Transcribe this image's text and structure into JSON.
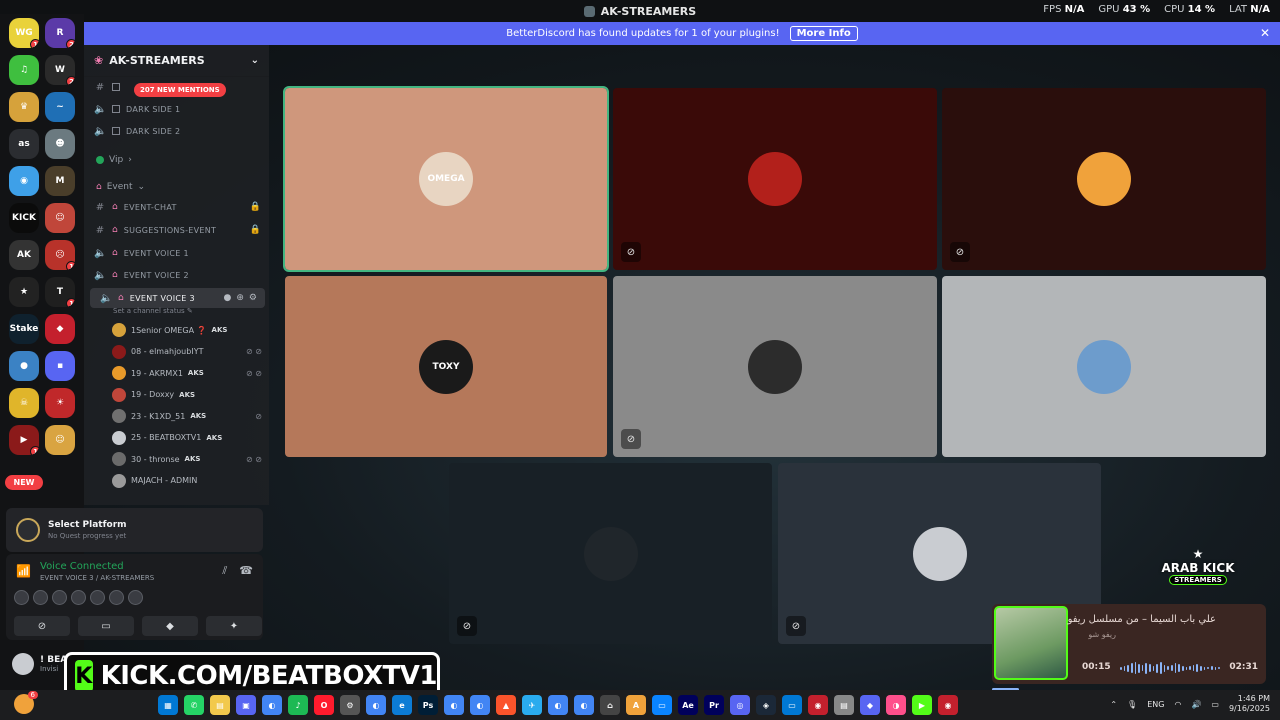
{
  "window": {
    "title": "AK-STREAMERS"
  },
  "stats": [
    {
      "label": "FPS",
      "value": "N/A"
    },
    {
      "label": "GPU",
      "value": "43 %"
    },
    {
      "label": "CPU",
      "value": "14 %"
    },
    {
      "label": "LAT",
      "value": "N/A"
    }
  ],
  "banner": {
    "text": "BetterDiscord has found updates for 1 of your plugins!",
    "button": "More Info",
    "close": "✕"
  },
  "rail": {
    "new_label": "NEW",
    "servers": [
      {
        "label": "WG",
        "badge": "1",
        "color": "#e9d23a"
      },
      {
        "label": "R",
        "badge": "2",
        "color": "#5b3aa8"
      },
      {
        "label": "♫",
        "badge": "",
        "color": "#3fbf3f"
      },
      {
        "label": "W",
        "badge": "2",
        "color": "#2a2a2a"
      },
      {
        "label": "♛",
        "badge": "",
        "color": "#d6a23b"
      },
      {
        "label": "~",
        "badge": "",
        "color": "#1f6fb5"
      },
      {
        "label": "as",
        "badge": "",
        "color": "#2b2d31"
      },
      {
        "label": "☻",
        "badge": "",
        "color": "#6b7a80"
      },
      {
        "label": "◉",
        "badge": "",
        "color": "#3ea0e8"
      },
      {
        "label": "M",
        "badge": "",
        "color": "#4a3e2a"
      },
      {
        "label": "KICK",
        "badge": "",
        "color": "#0b0b0b"
      },
      {
        "label": "☺",
        "badge": "",
        "color": "#c0463a"
      },
      {
        "label": "AK",
        "badge": "",
        "color": "#333"
      },
      {
        "label": "☹",
        "badge": "1",
        "color": "#b8322a"
      },
      {
        "label": "★",
        "badge": "",
        "color": "#222"
      },
      {
        "label": "T",
        "badge": "1",
        "color": "#1f1f1f"
      },
      {
        "label": "Stake",
        "badge": "",
        "color": "#0f212e"
      },
      {
        "label": "◆",
        "badge": "",
        "color": "#c4202d"
      },
      {
        "label": "●",
        "badge": "",
        "color": "#3b82c4"
      },
      {
        "label": "▪",
        "badge": "",
        "color": "#5865f2"
      },
      {
        "label": "☠",
        "badge": "",
        "color": "#e0b52a"
      },
      {
        "label": "☀",
        "badge": "",
        "color": "#c0282a"
      },
      {
        "label": "▶",
        "badge": "1",
        "color": "#8b1a1a"
      },
      {
        "label": "☺",
        "badge": "",
        "color": "#d9a441"
      }
    ]
  },
  "panel": {
    "server_name": "AK-STREAMERS",
    "mentions": "207 NEW MENTIONS",
    "channels_top": [
      {
        "icon": "#",
        "label": ""
      },
      {
        "icon": "🔊",
        "label": "DARK SIDE 1"
      },
      {
        "icon": "🔊",
        "label": "DARK SIDE 2"
      }
    ],
    "vip_label": "Vip",
    "event_label": "Event",
    "event_channels": [
      {
        "icon": "#",
        "label": "EVENT-CHAT",
        "right": "🔒"
      },
      {
        "icon": "#",
        "label": "SUGGESTIONS-EVENT",
        "right": "🔒"
      },
      {
        "icon": "🔊",
        "label": "EVENT VOICE 1",
        "right": ""
      },
      {
        "icon": "🔊",
        "label": "EVENT VOICE 2",
        "right": ""
      },
      {
        "icon": "🔊",
        "label": "EVENT VOICE 3",
        "right": ""
      }
    ],
    "set_status": "Set a channel status",
    "users": [
      {
        "name": "1Senior OMEGA ❓",
        "tag": "AKS",
        "tail": "",
        "color": "#d6a23b"
      },
      {
        "name": "08 - elmahjoubIYT",
        "tag": "",
        "tail": "⊘ ⊘",
        "color": "#8b1a1a"
      },
      {
        "name": "19 - AKRMX1",
        "tag": "AKS",
        "tail": "⊘ ⊘",
        "color": "#e89a2a"
      },
      {
        "name": "19 - Doxxy",
        "tag": "AKS",
        "tail": "",
        "color": "#c0463a"
      },
      {
        "name": "23 - K1XD_51",
        "tag": "AKS",
        "tail": "⊘",
        "color": "#707070"
      },
      {
        "name": "25 - BEATBOXTV1",
        "tag": "AKS",
        "tail": "",
        "color": "#c9ccd1"
      },
      {
        "name": "30 - thronse",
        "tag": "AKS",
        "tail": "⊘ ⊘",
        "color": "#6b6b6b"
      },
      {
        "name": "MAJACH - ADMIN",
        "tag": "",
        "tail": "",
        "color": "#9a9a9a"
      }
    ]
  },
  "quest": {
    "title": "Select Platform",
    "sub": "No Quest progress yet"
  },
  "voice": {
    "title": "Voice Connected",
    "channel": "EVENT VOICE 3 / AK-STREAMERS"
  },
  "userbar": {
    "name": "! BEAT",
    "status": "Invisi"
  },
  "tiles": [
    {
      "label": "OMEGA",
      "bg": "#cf977c",
      "av": "#e8d5c2",
      "speaking": true,
      "muted": false
    },
    {
      "label": "",
      "bg": "#3a0a08",
      "av": "#b2201b",
      "speaking": false,
      "muted": true
    },
    {
      "label": "",
      "bg": "#2a0e0c",
      "av": "#f0a23b",
      "speaking": false,
      "muted": true
    },
    {
      "label": "TOXY",
      "bg": "#b5785a",
      "av": "#1a1a1a",
      "speaking": false,
      "muted": false
    },
    {
      "label": "",
      "bg": "#8a8a8a",
      "av": "#2c2c2c",
      "speaking": false,
      "muted": true
    },
    {
      "label": "",
      "bg": "#b3b6b8",
      "av": "#6d9ccc",
      "speaking": false,
      "muted": false
    },
    {
      "label": "",
      "bg": "#182026",
      "av": "#20262b",
      "speaking": false,
      "muted": true
    },
    {
      "label": "",
      "bg": "#2a323b",
      "av": "#c9ccd1",
      "speaking": false,
      "muted": true
    }
  ],
  "kick_overlay": {
    "icon": "K",
    "url": "KICK.COM/BEATBOXTV1"
  },
  "ak_logo": {
    "line1": "ARAB KICK",
    "line2": "STREAMERS"
  },
  "player": {
    "song": "علي باب السيما – من مسلسل ريفو",
    "artist": "ريفو شو",
    "elapsed": "00:15",
    "total": "02:31",
    "progress": 0.1
  },
  "taskbar": {
    "weather_badge": "6",
    "lang": "ENG",
    "time": "1:46 PM",
    "date": "9/16/2025",
    "apps": [
      {
        "label": "▦",
        "color": "#0078d4"
      },
      {
        "label": "✆",
        "color": "#25d366"
      },
      {
        "label": "▤",
        "color": "#f2c94c"
      },
      {
        "label": "▣",
        "color": "#5865f2"
      },
      {
        "label": "◐",
        "color": "#4285f4"
      },
      {
        "label": "♪",
        "color": "#1db954"
      },
      {
        "label": "O",
        "color": "#ff1b2d"
      },
      {
        "label": "⚙",
        "color": "#555"
      },
      {
        "label": "◐",
        "color": "#4285f4"
      },
      {
        "label": "e",
        "color": "#0c7cd5"
      },
      {
        "label": "Ps",
        "color": "#001e36"
      },
      {
        "label": "◐",
        "color": "#4285f4"
      },
      {
        "label": "◐",
        "color": "#4285f4"
      },
      {
        "label": "▲",
        "color": "#fb542b"
      },
      {
        "label": "✈",
        "color": "#2aabee"
      },
      {
        "label": "◐",
        "color": "#4285f4"
      },
      {
        "label": "◐",
        "color": "#4285f4"
      },
      {
        "label": "⌂",
        "color": "#444"
      },
      {
        "label": "A",
        "color": "#f0a23b"
      },
      {
        "label": "▭",
        "color": "#0a84ff"
      },
      {
        "label": "Ae",
        "color": "#00005b"
      },
      {
        "label": "Pr",
        "color": "#00005b"
      },
      {
        "label": "◎",
        "color": "#5865f2"
      },
      {
        "label": "◈",
        "color": "#1b2838"
      },
      {
        "label": "▭",
        "color": "#0078d4"
      },
      {
        "label": "◉",
        "color": "#c4202d"
      },
      {
        "label": "▤",
        "color": "#888"
      },
      {
        "label": "◆",
        "color": "#5865f2"
      },
      {
        "label": "◑",
        "color": "#ff4f8b"
      },
      {
        "label": "▶",
        "color": "#53fc18"
      },
      {
        "label": "◉",
        "color": "#c4202d"
      }
    ]
  }
}
